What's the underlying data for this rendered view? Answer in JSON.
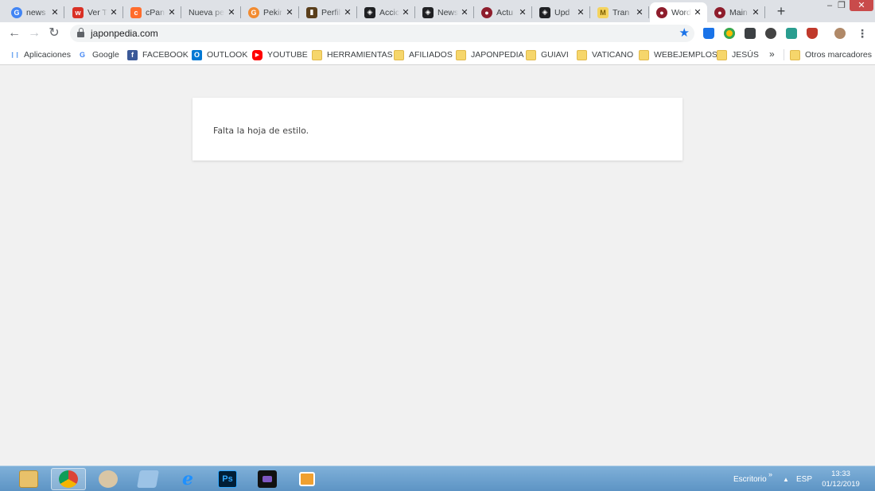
{
  "tabs": [
    {
      "title": "news",
      "favicon_icon": "google-icon",
      "color": "#4285f4",
      "glyph": "G"
    },
    {
      "title": "Ver T",
      "favicon_icon": "w-icon",
      "color": "#d93025",
      "glyph": "w"
    },
    {
      "title": "cPan",
      "favicon_icon": "cpanel-icon",
      "color": "#ff6c2c",
      "glyph": "c"
    },
    {
      "title": "Nueva pe",
      "favicon_icon": "",
      "color": "",
      "glyph": ""
    },
    {
      "title": "Pekir",
      "favicon_icon": "g-orange-icon",
      "color": "#f28b30",
      "glyph": "G"
    },
    {
      "title": "Perfil",
      "favicon_icon": "book-icon",
      "color": "#5a3e1b",
      "glyph": "▮"
    },
    {
      "title": "Accic",
      "favicon_icon": "eye-icon",
      "color": "#202124",
      "glyph": "◈"
    },
    {
      "title": "News",
      "favicon_icon": "eye-icon",
      "color": "#202124",
      "glyph": "◈"
    },
    {
      "title": "Actu",
      "favicon_icon": "avatar-icon",
      "color": "#8e1d2c",
      "glyph": "●"
    },
    {
      "title": "Upd",
      "favicon_icon": "eye-icon",
      "color": "#202124",
      "glyph": "◈"
    },
    {
      "title": "Tran",
      "favicon_icon": "m-icon",
      "color": "#f4d35e",
      "glyph": "M"
    },
    {
      "title": "Word",
      "favicon_icon": "avatar-icon",
      "color": "#8e1d2c",
      "glyph": "●",
      "active": true
    },
    {
      "title": "Main",
      "favicon_icon": "avatar-icon",
      "color": "#8e1d2c",
      "glyph": "●"
    }
  ],
  "toolbar": {
    "url": "japonpedia.com"
  },
  "bookmarks": [
    {
      "label": "Aplicaciones",
      "icon": "apps-grid-icon",
      "color": "#1a73e8"
    },
    {
      "label": "Google",
      "icon": "google-icon",
      "color": "#4285f4"
    },
    {
      "label": "FACEBOOK",
      "icon": "facebook-icon",
      "color": "#3b5998"
    },
    {
      "label": "OUTLOOK",
      "icon": "outlook-icon",
      "color": "#0078d4"
    },
    {
      "label": "YOUTUBE",
      "icon": "youtube-icon",
      "color": "#ff0000"
    },
    {
      "label": "HERRAMIENTAS",
      "icon": "folder-icon",
      "color": "#f6d66b"
    },
    {
      "label": "AFILIADOS",
      "icon": "folder-icon",
      "color": "#f6d66b"
    },
    {
      "label": "JAPONPEDIA",
      "icon": "folder-icon",
      "color": "#f6d66b"
    },
    {
      "label": "GUIAVI",
      "icon": "folder-icon",
      "color": "#f6d66b"
    },
    {
      "label": "VATICANO",
      "icon": "folder-icon",
      "color": "#f6d66b"
    },
    {
      "label": "WEBEJEMPLOS",
      "icon": "folder-icon",
      "color": "#f6d66b"
    },
    {
      "label": "JESÚS",
      "icon": "folder-icon",
      "color": "#f6d66b"
    }
  ],
  "bookmarks_overflow": "»",
  "other_bookmarks": "Otros marcadores",
  "page": {
    "message": "Falta la hoja de estilo."
  },
  "taskbar": {
    "apps": [
      "file-explorer-icon",
      "chrome-icon",
      "paint-icon",
      "notepad-icon",
      "internet-explorer-icon",
      "photoshop-icon",
      "video-icon",
      "media-player-icon"
    ],
    "photoshop_label": "Ps",
    "desktop_label": "Escritorio",
    "chevron": "»",
    "language": "ESP",
    "time": "13:33",
    "date": "01/12/2019"
  }
}
